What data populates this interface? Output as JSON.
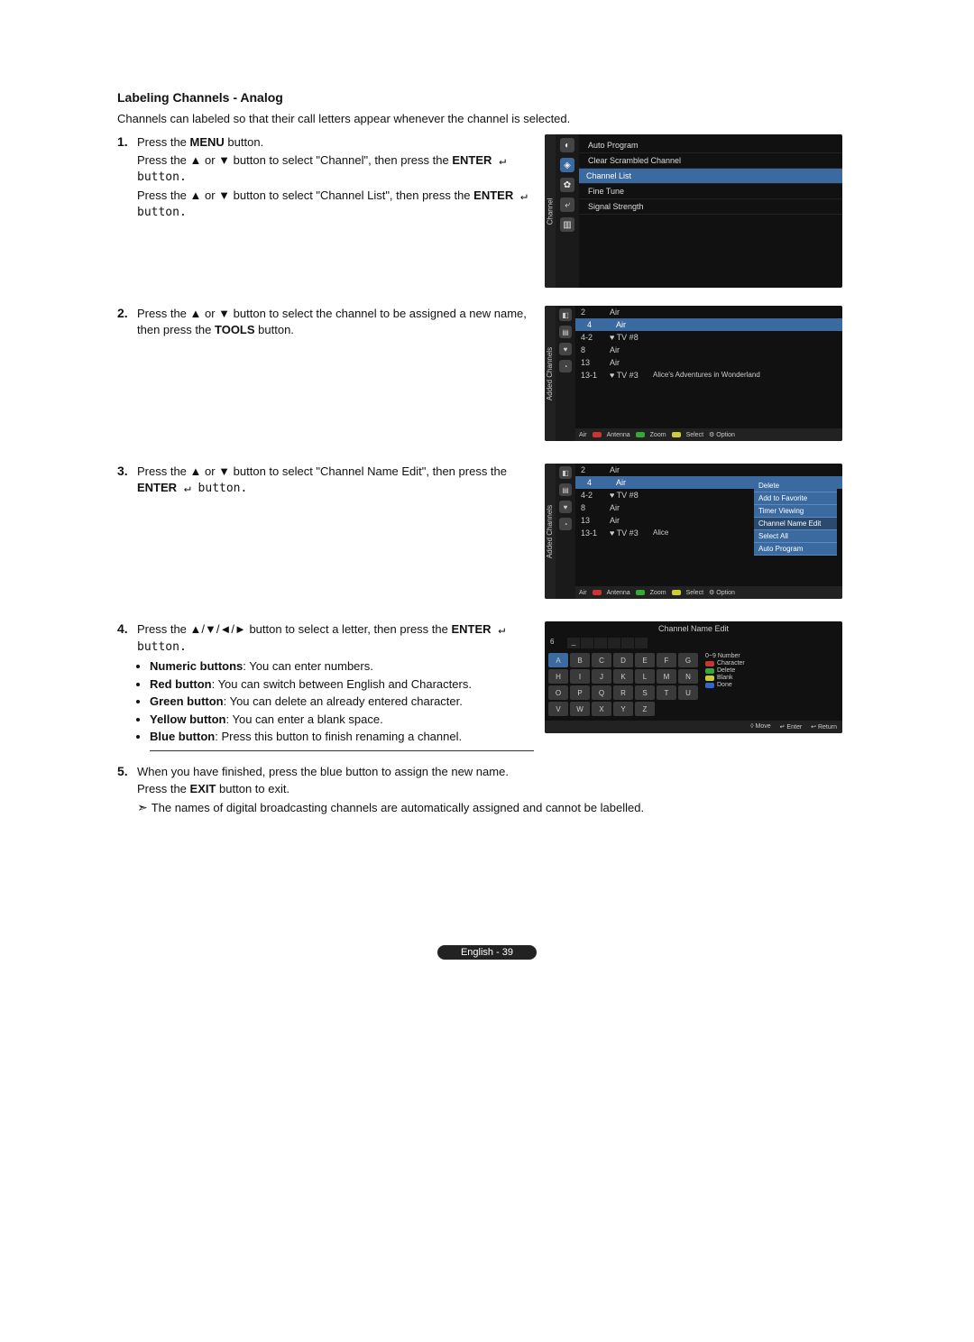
{
  "title": "Labeling Channels - Analog",
  "intro": "Channels can labeled so that their call letters appear whenever the channel is selected.",
  "steps": {
    "s1": {
      "num": "1.",
      "l1_a": "Press the ",
      "l1_b": "MENU",
      "l1_c": " button.",
      "l2_a": "Press the ▲ or ▼ button to select \"Channel\", then press the ",
      "l2_b": "ENTER",
      "l2_c": " ↵ button.",
      "l3_a": "Press the ▲ or ▼ button to select \"Channel List\", then press the ",
      "l3_b": "ENTER",
      "l3_c": " ↵ button."
    },
    "s2": {
      "num": "2.",
      "l1_a": "Press the ▲ or ▼ button to select the channel to be assigned a new name, then press the ",
      "l1_b": "TOOLS",
      "l1_c": " button."
    },
    "s3": {
      "num": "3.",
      "l1_a": "Press the ▲ or ▼ button to select \"Channel Name Edit\", then press the ",
      "l1_b": "ENTER",
      "l1_c": " ↵ button."
    },
    "s4": {
      "num": "4.",
      "l1_a": "Press the ▲/▼/◄/► button to select a letter, then press the ",
      "l1_b": "ENTER",
      "l1_c": " ↵ button.",
      "b1_b": "Numeric buttons",
      "b1_c": ": You can enter numbers.",
      "b2_b": "Red button",
      "b2_c": ": You can switch between English and Characters.",
      "b3_b": "Green button",
      "b3_c": ": You can delete an already entered character.",
      "b4_b": "Yellow button",
      "b4_c": ": You can enter a blank space.",
      "b5_b": "Blue button",
      "b5_c": ": Press this button to finish renaming a channel."
    },
    "s5": {
      "num": "5.",
      "l1": "When you have finished, press the blue button to assign the new name.",
      "l2_a": "Press the ",
      "l2_b": "EXIT",
      "l2_c": " button to exit.",
      "note": "The names of digital broadcasting channels are automatically assigned and cannot be labelled."
    }
  },
  "shot1": {
    "sidelabel": "Channel",
    "items": [
      "Auto Program",
      "Clear Scrambled Channel",
      "Channel List",
      "Fine Tune",
      "Signal Strength"
    ],
    "highlightIdx": 2
  },
  "shot2": {
    "sidelabel": "Added Channels",
    "rows": [
      {
        "c1": "2",
        "c2": "Air",
        "c3": ""
      },
      {
        "c1": "4",
        "c2": "Air",
        "c3": ""
      },
      {
        "c1": "4-2",
        "c2": "♥ TV #8",
        "c3": ""
      },
      {
        "c1": "8",
        "c2": "Air",
        "c3": ""
      },
      {
        "c1": "13",
        "c2": "Air",
        "c3": ""
      },
      {
        "c1": "13-1",
        "c2": "♥ TV #3",
        "c3": "Alice's Adventures in Wonderland"
      }
    ],
    "highlightIdx": 1,
    "footer": {
      "air": "Air",
      "red": "Antenna",
      "green": "Zoom",
      "ylw": "Select",
      "tool": "⚙ Option"
    }
  },
  "shot3": {
    "sidelabel": "Added Channels",
    "rows": [
      {
        "c1": "2",
        "c2": "Air",
        "c3": ""
      },
      {
        "c1": "4",
        "c2": "Air",
        "c3": ""
      },
      {
        "c1": "4-2",
        "c2": "♥ TV #8",
        "c3": ""
      },
      {
        "c1": "8",
        "c2": "Air",
        "c3": ""
      },
      {
        "c1": "13",
        "c2": "Air",
        "c3": ""
      },
      {
        "c1": "13-1",
        "c2": "♥ TV #3",
        "c3": "Alice"
      }
    ],
    "popup": [
      "Delete",
      "Add to Favorite",
      "Timer Viewing",
      "Channel Name Edit",
      "Select All",
      "Auto Program"
    ],
    "popupSel": 3,
    "footer": {
      "air": "Air",
      "red": "Antenna",
      "green": "Zoom",
      "ylw": "Select",
      "tool": "⚙ Option"
    }
  },
  "shot4": {
    "title": "Channel Name Edit",
    "editnum": "6",
    "editdash": "_",
    "rows": [
      [
        "A",
        "B",
        "C",
        "D",
        "E",
        "F",
        "G"
      ],
      [
        "H",
        "I",
        "J",
        "K",
        "L",
        "M",
        "N"
      ],
      [
        "O",
        "P",
        "Q",
        "R",
        "S",
        "T",
        "U"
      ],
      [
        "V",
        "W",
        "X",
        "Y",
        "Z",
        "",
        ""
      ]
    ],
    "selected": "A",
    "legend": {
      "num": "0~9  Number",
      "red": "Character",
      "grn": "Delete",
      "ylw": "Blank",
      "blu": "Done"
    },
    "footer": {
      "move": "◊ Move",
      "enter": "↵ Enter",
      "ret": "↩ Return"
    }
  },
  "pagefoot": "English - 39"
}
